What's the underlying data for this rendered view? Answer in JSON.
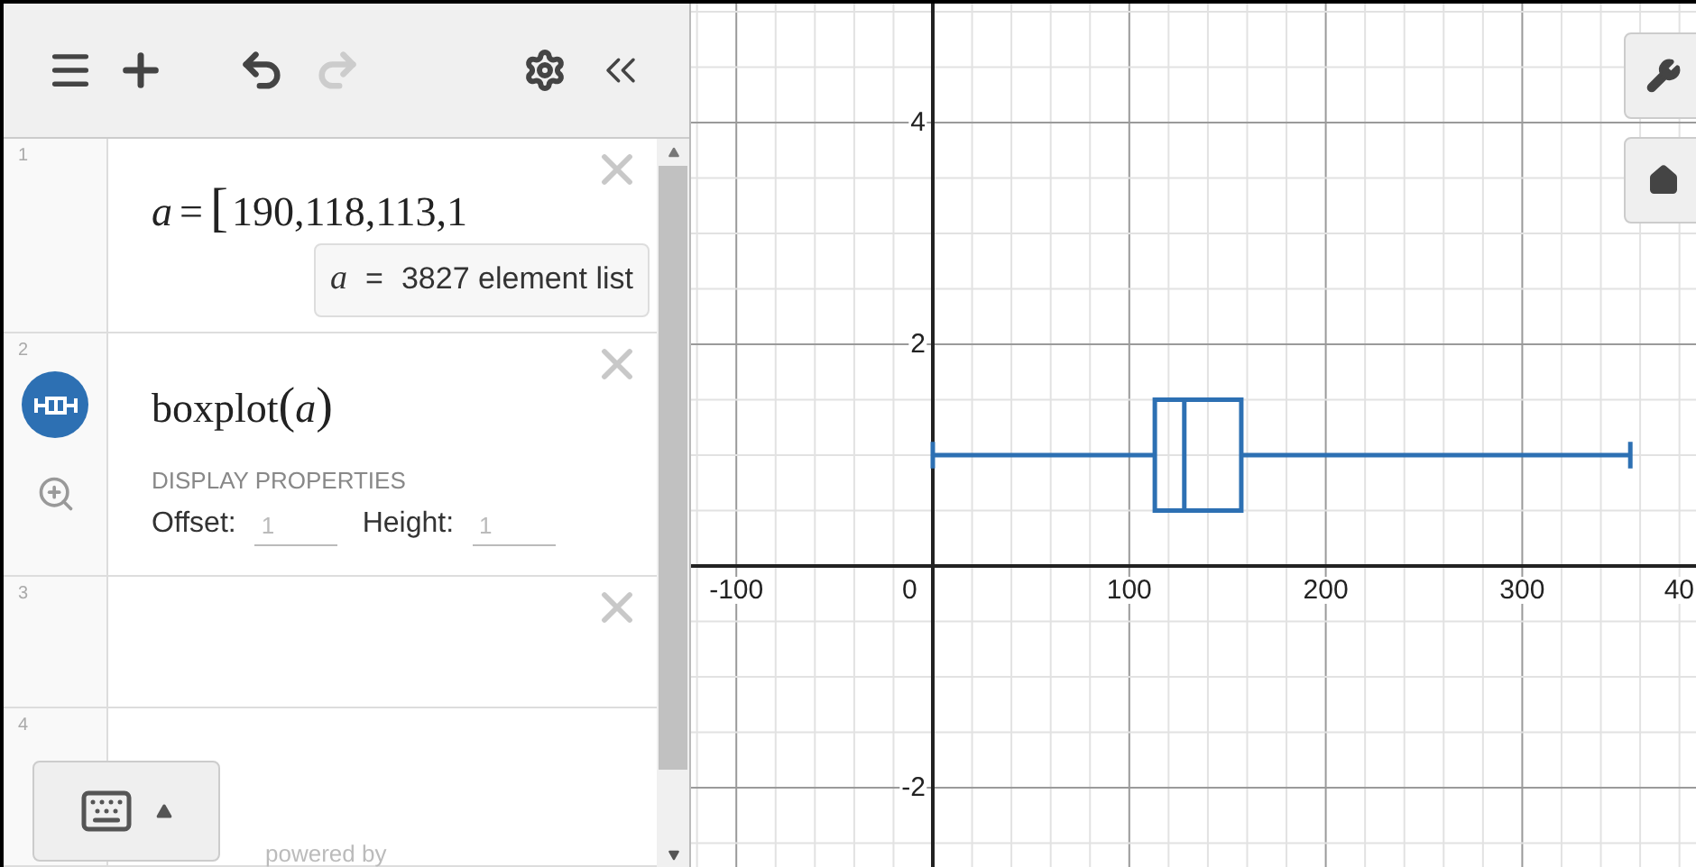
{
  "toolbar": {
    "undo": {
      "disabled": false
    },
    "redo": {
      "disabled": true
    }
  },
  "expressions": [
    {
      "index": "1",
      "kind": "list",
      "variable": "a",
      "equals": "=",
      "bracket": "[",
      "values": "190,118,113,1",
      "note": {
        "variable": "a",
        "equals": "=",
        "text": "3827 element list"
      },
      "deletable": true
    },
    {
      "index": "2",
      "kind": "boxplot",
      "color": "#2d70b3",
      "func": "boxplot",
      "open": "(",
      "arg": "a",
      "close": ")",
      "heading": "DISPLAY PROPERTIES",
      "fields": [
        {
          "label": "Offset:",
          "placeholder": "1"
        },
        {
          "label": "Height:",
          "placeholder": "1"
        }
      ],
      "deletable": true
    },
    {
      "index": "3",
      "kind": "empty",
      "deletable": true
    },
    {
      "index": "4",
      "kind": "empty",
      "deletable": false
    }
  ],
  "footer": "powered by",
  "graph": {
    "x_ticks": [
      "-100",
      "0",
      "100",
      "200",
      "300",
      "40"
    ],
    "y_ticks": [
      "4",
      "2",
      "-2"
    ]
  }
}
